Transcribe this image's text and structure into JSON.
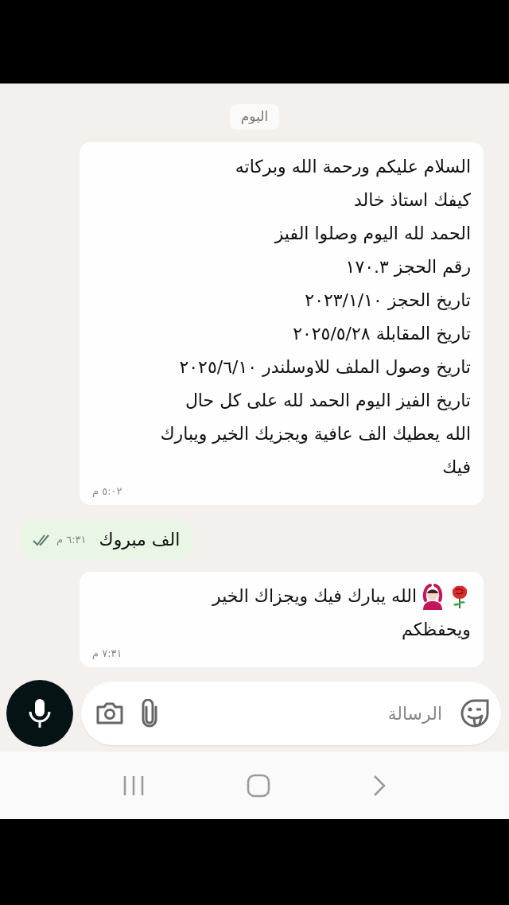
{
  "date_chip": "اليوم",
  "messages": [
    {
      "kind": "in",
      "lines": [
        "السلام عليكم ورحمة الله وبركاته",
        "كيفك استاذ خالد",
        "الحمد لله اليوم وصلوا الفيز",
        "رقم الحجز ١٧٠.٣",
        "تاريخ الحجز ٢٠٢٣/١/١٠",
        "تاريخ المقابلة ٢٠٢٥/٥/٢٨",
        "تاريخ وصول الملف للاوسلندر ٢٠٢٥/٦/١٠",
        "تاريخ الفيز اليوم الحمد لله على كل حال",
        "الله يعطيك الف عافية ويجزيك الخير ويبارك",
        "فيك"
      ],
      "time": "٥:٠٢ م"
    },
    {
      "kind": "out",
      "lines": [
        "الف مبروك"
      ],
      "time": "٦:٣١ م",
      "read": true
    },
    {
      "kind": "in",
      "lines": [
        "الله يبارك فيك ويجزاك الخير",
        "ويحفظكم"
      ],
      "time": "٧:٣١ م",
      "emoji_lead": true
    }
  ],
  "composer": {
    "placeholder": "الرسالة"
  }
}
